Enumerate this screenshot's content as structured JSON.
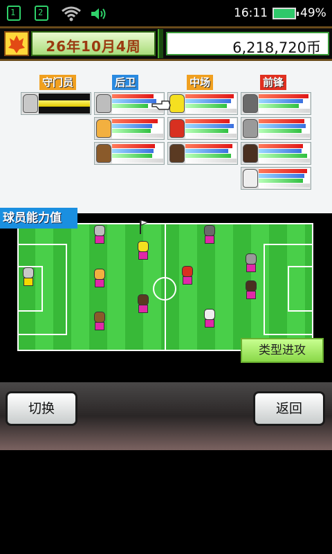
{
  "status_bar": {
    "sim1": "1",
    "sim2": "2",
    "wifi_icon": "wifi-icon",
    "sound_icon": "speaker-icon",
    "time": "16:11",
    "battery_percent": "49%"
  },
  "header": {
    "date": "26年10月4周",
    "coins": "6,218,720币"
  },
  "positions": {
    "gk": "守门员",
    "df": "后卫",
    "mf": "中场",
    "fw": "前锋"
  },
  "field_tab": "球员能力值",
  "tactic_button": "类型进攻",
  "buttons": {
    "switch": "切换",
    "back": "返回"
  },
  "colors": {
    "kit_pink": "#e028a8",
    "gk_kit": "#f5d800",
    "pitch_green": "#3fc33f"
  }
}
